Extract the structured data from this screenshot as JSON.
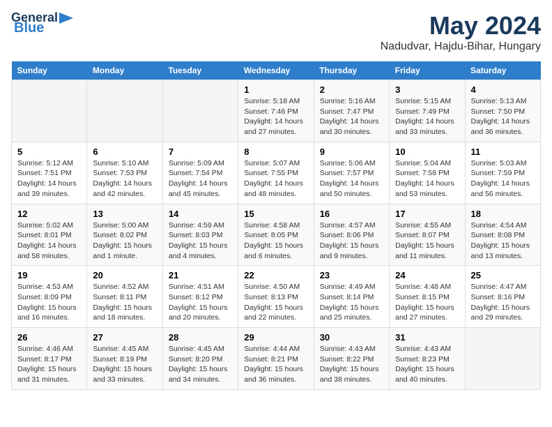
{
  "header": {
    "logo_line1": "General",
    "logo_line2": "Blue",
    "title": "May 2024",
    "subtitle": "Nadudvar, Hajdu-Bihar, Hungary"
  },
  "weekdays": [
    "Sunday",
    "Monday",
    "Tuesday",
    "Wednesday",
    "Thursday",
    "Friday",
    "Saturday"
  ],
  "weeks": [
    [
      {
        "day": "",
        "info": ""
      },
      {
        "day": "",
        "info": ""
      },
      {
        "day": "",
        "info": ""
      },
      {
        "day": "1",
        "info": "Sunrise: 5:18 AM\nSunset: 7:46 PM\nDaylight: 14 hours\nand 27 minutes."
      },
      {
        "day": "2",
        "info": "Sunrise: 5:16 AM\nSunset: 7:47 PM\nDaylight: 14 hours\nand 30 minutes."
      },
      {
        "day": "3",
        "info": "Sunrise: 5:15 AM\nSunset: 7:49 PM\nDaylight: 14 hours\nand 33 minutes."
      },
      {
        "day": "4",
        "info": "Sunrise: 5:13 AM\nSunset: 7:50 PM\nDaylight: 14 hours\nand 36 minutes."
      }
    ],
    [
      {
        "day": "5",
        "info": "Sunrise: 5:12 AM\nSunset: 7:51 PM\nDaylight: 14 hours\nand 39 minutes."
      },
      {
        "day": "6",
        "info": "Sunrise: 5:10 AM\nSunset: 7:53 PM\nDaylight: 14 hours\nand 42 minutes."
      },
      {
        "day": "7",
        "info": "Sunrise: 5:09 AM\nSunset: 7:54 PM\nDaylight: 14 hours\nand 45 minutes."
      },
      {
        "day": "8",
        "info": "Sunrise: 5:07 AM\nSunset: 7:55 PM\nDaylight: 14 hours\nand 48 minutes."
      },
      {
        "day": "9",
        "info": "Sunrise: 5:06 AM\nSunset: 7:57 PM\nDaylight: 14 hours\nand 50 minutes."
      },
      {
        "day": "10",
        "info": "Sunrise: 5:04 AM\nSunset: 7:58 PM\nDaylight: 14 hours\nand 53 minutes."
      },
      {
        "day": "11",
        "info": "Sunrise: 5:03 AM\nSunset: 7:59 PM\nDaylight: 14 hours\nand 56 minutes."
      }
    ],
    [
      {
        "day": "12",
        "info": "Sunrise: 5:02 AM\nSunset: 8:01 PM\nDaylight: 14 hours\nand 58 minutes."
      },
      {
        "day": "13",
        "info": "Sunrise: 5:00 AM\nSunset: 8:02 PM\nDaylight: 15 hours\nand 1 minute."
      },
      {
        "day": "14",
        "info": "Sunrise: 4:59 AM\nSunset: 8:03 PM\nDaylight: 15 hours\nand 4 minutes."
      },
      {
        "day": "15",
        "info": "Sunrise: 4:58 AM\nSunset: 8:05 PM\nDaylight: 15 hours\nand 6 minutes."
      },
      {
        "day": "16",
        "info": "Sunrise: 4:57 AM\nSunset: 8:06 PM\nDaylight: 15 hours\nand 9 minutes."
      },
      {
        "day": "17",
        "info": "Sunrise: 4:55 AM\nSunset: 8:07 PM\nDaylight: 15 hours\nand 11 minutes."
      },
      {
        "day": "18",
        "info": "Sunrise: 4:54 AM\nSunset: 8:08 PM\nDaylight: 15 hours\nand 13 minutes."
      }
    ],
    [
      {
        "day": "19",
        "info": "Sunrise: 4:53 AM\nSunset: 8:09 PM\nDaylight: 15 hours\nand 16 minutes."
      },
      {
        "day": "20",
        "info": "Sunrise: 4:52 AM\nSunset: 8:11 PM\nDaylight: 15 hours\nand 18 minutes."
      },
      {
        "day": "21",
        "info": "Sunrise: 4:51 AM\nSunset: 8:12 PM\nDaylight: 15 hours\nand 20 minutes."
      },
      {
        "day": "22",
        "info": "Sunrise: 4:50 AM\nSunset: 8:13 PM\nDaylight: 15 hours\nand 22 minutes."
      },
      {
        "day": "23",
        "info": "Sunrise: 4:49 AM\nSunset: 8:14 PM\nDaylight: 15 hours\nand 25 minutes."
      },
      {
        "day": "24",
        "info": "Sunrise: 4:48 AM\nSunset: 8:15 PM\nDaylight: 15 hours\nand 27 minutes."
      },
      {
        "day": "25",
        "info": "Sunrise: 4:47 AM\nSunset: 8:16 PM\nDaylight: 15 hours\nand 29 minutes."
      }
    ],
    [
      {
        "day": "26",
        "info": "Sunrise: 4:46 AM\nSunset: 8:17 PM\nDaylight: 15 hours\nand 31 minutes."
      },
      {
        "day": "27",
        "info": "Sunrise: 4:45 AM\nSunset: 8:19 PM\nDaylight: 15 hours\nand 33 minutes."
      },
      {
        "day": "28",
        "info": "Sunrise: 4:45 AM\nSunset: 8:20 PM\nDaylight: 15 hours\nand 34 minutes."
      },
      {
        "day": "29",
        "info": "Sunrise: 4:44 AM\nSunset: 8:21 PM\nDaylight: 15 hours\nand 36 minutes."
      },
      {
        "day": "30",
        "info": "Sunrise: 4:43 AM\nSunset: 8:22 PM\nDaylight: 15 hours\nand 38 minutes."
      },
      {
        "day": "31",
        "info": "Sunrise: 4:43 AM\nSunset: 8:23 PM\nDaylight: 15 hours\nand 40 minutes."
      },
      {
        "day": "",
        "info": ""
      }
    ]
  ]
}
